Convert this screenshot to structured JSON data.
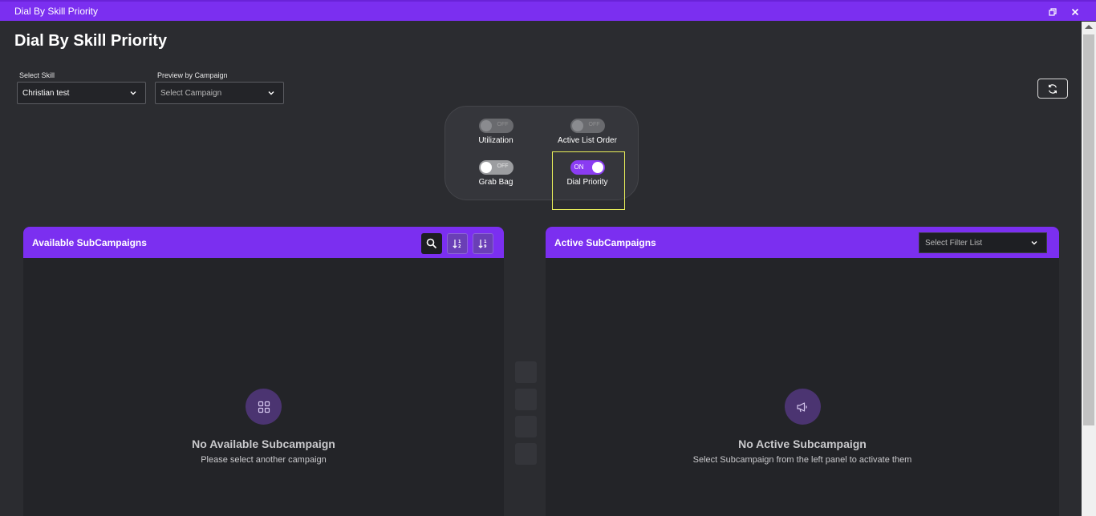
{
  "window": {
    "title": "Dial By Skill Priority",
    "restore_icon": "restore-window-icon",
    "close_icon": "close-icon"
  },
  "page": {
    "title": "Dial By Skill Priority"
  },
  "filters": {
    "skill_label": "Select Skill",
    "skill_value": "Christian test",
    "campaign_label": "Preview by Campaign",
    "campaign_placeholder": "Select Campaign"
  },
  "toggles": [
    {
      "label": "Utilization",
      "state": "OFF"
    },
    {
      "label": "Active List Order",
      "state": "OFF"
    },
    {
      "label": "Grab Bag",
      "state": "OFF"
    },
    {
      "label": "Dial Priority",
      "state": "ON"
    }
  ],
  "available_panel": {
    "title": "Available SubCampaigns",
    "empty_title": "No Available Subcampaign",
    "empty_subtitle": "Please select another campaign"
  },
  "active_panel": {
    "title": "Active SubCampaigns",
    "filter_placeholder": "Select Filter List",
    "empty_title": "No Active Subcampaign",
    "empty_subtitle": "Select Subcampaign from the left panel to activate them"
  },
  "colors": {
    "accent": "#7b2ff0",
    "background": "#2b2c30",
    "highlight": "#e9ef5a"
  }
}
